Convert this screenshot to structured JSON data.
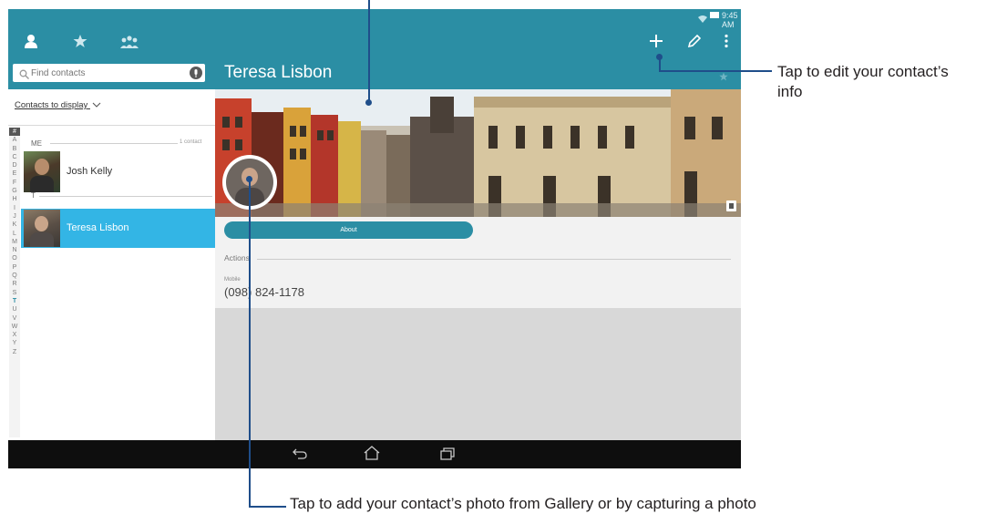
{
  "status_bar": {
    "time": "9:45 AM"
  },
  "tabs": [
    {
      "icon": "person-icon"
    },
    {
      "icon": "star-icon"
    },
    {
      "icon": "group-icon"
    }
  ],
  "search": {
    "placeholder": "Find contacts"
  },
  "filter": {
    "label": "Contacts to display"
  },
  "alphabet": [
    "#",
    "A",
    "B",
    "C",
    "D",
    "E",
    "F",
    "G",
    "H",
    "I",
    "J",
    "K",
    "L",
    "M",
    "N",
    "O",
    "P",
    "Q",
    "R",
    "S",
    "T",
    "U",
    "V",
    "W",
    "X",
    "Y",
    "Z"
  ],
  "alphabet_active": "T",
  "sections": {
    "me": {
      "header": "ME",
      "count": "1 contact"
    },
    "t": {
      "header": "T"
    }
  },
  "contacts": [
    {
      "name": "Josh Kelly"
    },
    {
      "name": "Teresa Lisbon"
    }
  ],
  "detail": {
    "name": "Teresa Lisbon",
    "about_label": "About",
    "actions_label": "Actions",
    "phone_type": "Mobile",
    "phone_number": "(098) 824-1178"
  },
  "callouts": {
    "edit": {
      "line1": "Tap to edit your contact’s",
      "line2": "info"
    },
    "photo": "Tap to add your contact’s photo from Gallery or by capturing a photo"
  },
  "colors": {
    "accent": "#2b8ea4",
    "selected": "#33b5e5",
    "callout_line": "#1f4e8a"
  }
}
